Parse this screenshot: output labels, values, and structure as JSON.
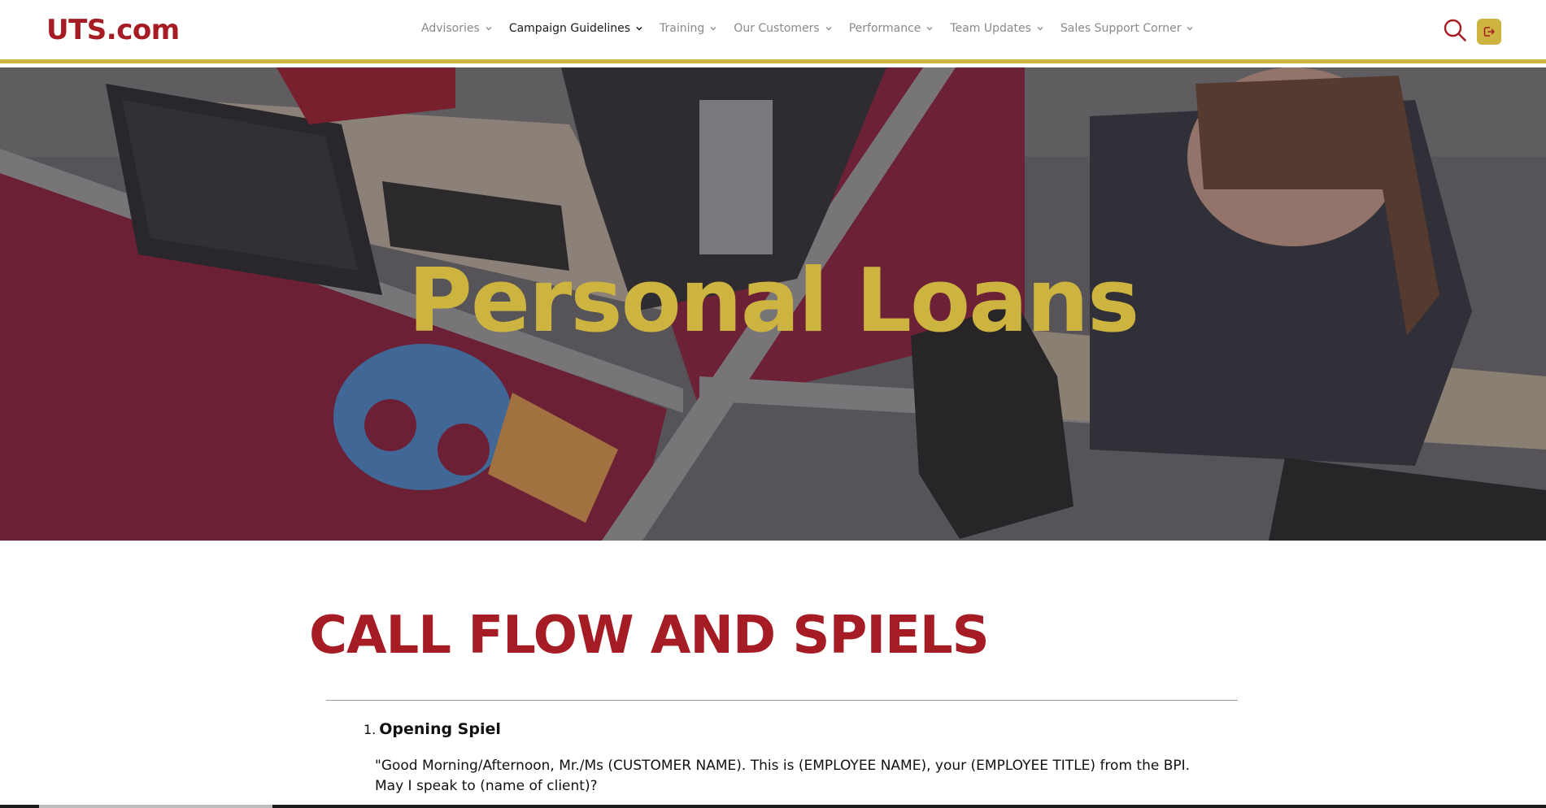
{
  "header": {
    "logo": "UTS.com",
    "nav": [
      {
        "label": "Advisories",
        "active": false
      },
      {
        "label": "Campaign Guidelines",
        "active": true
      },
      {
        "label": "Training",
        "active": false
      },
      {
        "label": "Our Customers",
        "active": false
      },
      {
        "label": "Performance",
        "active": false
      },
      {
        "label": "Team Updates",
        "active": false
      },
      {
        "label": "Sales Support Corner",
        "active": false
      }
    ],
    "icons": {
      "search": "search-icon",
      "logout": "logout-icon"
    }
  },
  "hero": {
    "title": "Personal Loans"
  },
  "content": {
    "section_title": "CALL FLOW AND SPIELS",
    "steps": [
      {
        "number": "1.",
        "title": "Opening Spiel",
        "text": "\"Good Morning/Afternoon, Mr./Ms (CUSTOMER NAME). This is (EMPLOYEE NAME), your (EMPLOYEE TITLE) from the BPI. May I speak to (name of client)?"
      }
    ]
  },
  "colors": {
    "brand_red": "#a51c24",
    "brand_gold": "#cdb33f"
  }
}
